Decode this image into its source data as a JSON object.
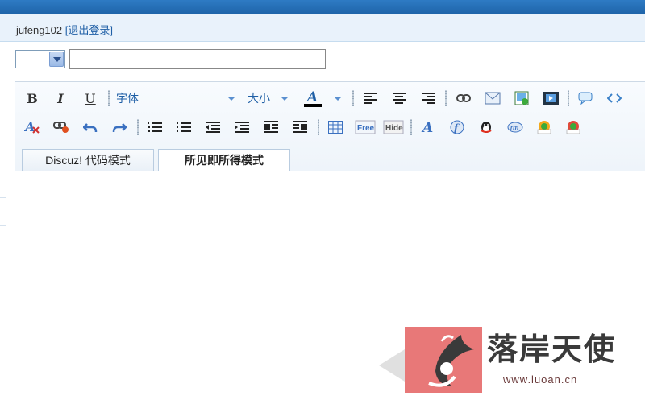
{
  "header": {
    "username": "jufeng102",
    "logout_label": "[退出登录]"
  },
  "form": {
    "type_select_value": "",
    "title_value": ""
  },
  "toolbar": {
    "bold": "B",
    "italic": "I",
    "underline": "U",
    "font_label": "字体",
    "size_label": "大小",
    "fontcolor_glyph": "A",
    "free_label": "Free",
    "hide_label": "Hide"
  },
  "tabs": [
    {
      "label": "Discuz! 代码模式",
      "active": false
    },
    {
      "label": "所见即所得模式",
      "active": true
    }
  ],
  "editor": {
    "content": ""
  },
  "watermark": {
    "name": "落岸天使",
    "url": "www.luoan.cn"
  },
  "icons": [
    "bold-icon",
    "italic-icon",
    "underline-icon",
    "font-dropdown-icon",
    "size-dropdown-icon",
    "font-color-icon",
    "align-left-icon",
    "align-center-icon",
    "align-right-icon",
    "link-icon",
    "email-icon",
    "image-icon",
    "media-icon",
    "quote-icon",
    "code-icon",
    "remove-format-icon",
    "unlink-icon",
    "undo-icon",
    "redo-icon",
    "ordered-list-icon",
    "unordered-list-icon",
    "outdent-icon",
    "indent-icon",
    "float-left-icon",
    "float-right-icon",
    "table-icon",
    "free-icon",
    "hide-icon",
    "font-style-icon",
    "flash-icon",
    "qq-icon",
    "rm-icon",
    "wma-icon",
    "wmv-icon"
  ],
  "colors": {
    "topbar": "#1e63a8",
    "userbar_bg": "#e9f2fb",
    "link": "#1f5fa6",
    "font_color_bar": "#000000",
    "watermark_red": "#e87878"
  }
}
